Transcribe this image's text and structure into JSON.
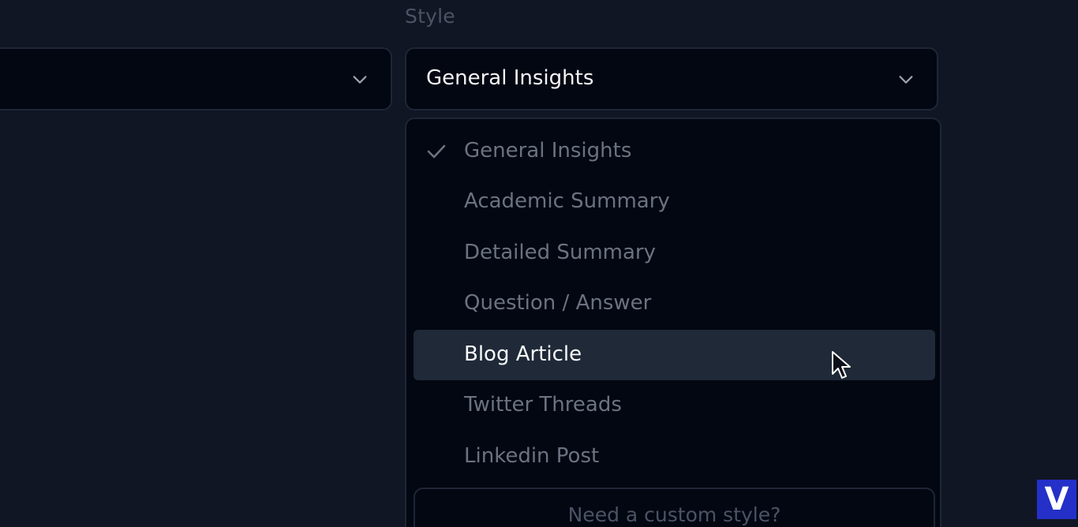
{
  "style_field": {
    "label": "Style",
    "selected_value": "General Insights"
  },
  "left_select": {
    "value": ""
  },
  "dropdown": {
    "options": [
      {
        "label": "General Insights",
        "checked": true
      },
      {
        "label": "Academic Summary",
        "checked": false
      },
      {
        "label": "Detailed Summary",
        "checked": false
      },
      {
        "label": "Question / Answer",
        "checked": false
      },
      {
        "label": "Blog Article",
        "checked": false,
        "hovered": true
      },
      {
        "label": "Twitter Threads",
        "checked": false
      },
      {
        "label": "Linkedin Post",
        "checked": false
      }
    ],
    "custom_style_label": "Need a custom style?"
  },
  "watermark": {
    "letter": "V",
    "color": "#2430c8"
  },
  "colors": {
    "background": "#111625",
    "field_bg": "#030712",
    "border": "#1e2636",
    "hover_bg": "#1f2937",
    "muted_text": "#6b7280"
  }
}
